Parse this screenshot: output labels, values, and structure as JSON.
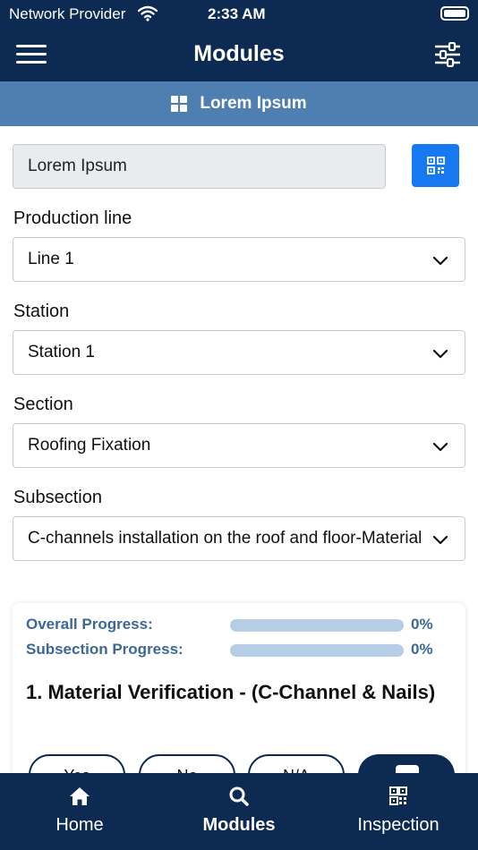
{
  "status_bar": {
    "carrier": "Network Provider",
    "time": "2:33 AM"
  },
  "header": {
    "title": "Modules"
  },
  "sub_header": {
    "label": "Lorem Ipsum"
  },
  "form": {
    "id_value": "Lorem Ipsum",
    "production_line": {
      "label": "Production line",
      "value": "Line 1"
    },
    "station": {
      "label": "Station",
      "value": "Station 1"
    },
    "section": {
      "label": "Section",
      "value": "Roofing Fixation"
    },
    "subsection": {
      "label": "Subsection",
      "value": "C-channels installation on the roof and floor-Material Verification"
    }
  },
  "progress": {
    "overall_label": "Overall Progress:",
    "overall_value": "0%",
    "overall_fraction": 0,
    "subsection_label": "Subsection Progress:",
    "subsection_value": "0%",
    "subsection_fraction": 0
  },
  "checklist": {
    "title": "1. Material Verification - (C-Channel & Nails)"
  },
  "answers": {
    "yes": "Yes",
    "no": "No",
    "na": "N/A"
  },
  "bottom_nav": [
    {
      "label": "Home",
      "icon": "home-icon"
    },
    {
      "label": "Modules",
      "icon": "search-icon",
      "active": true
    },
    {
      "label": "Inspection",
      "icon": "qr-code-icon"
    }
  ],
  "colors": {
    "navy": "#0c2a52",
    "subheader_blue": "#4f7fb1",
    "qr_button_blue": "#1679f2",
    "progress_text": "#3c6797",
    "progress_track": "#b6cde6"
  }
}
